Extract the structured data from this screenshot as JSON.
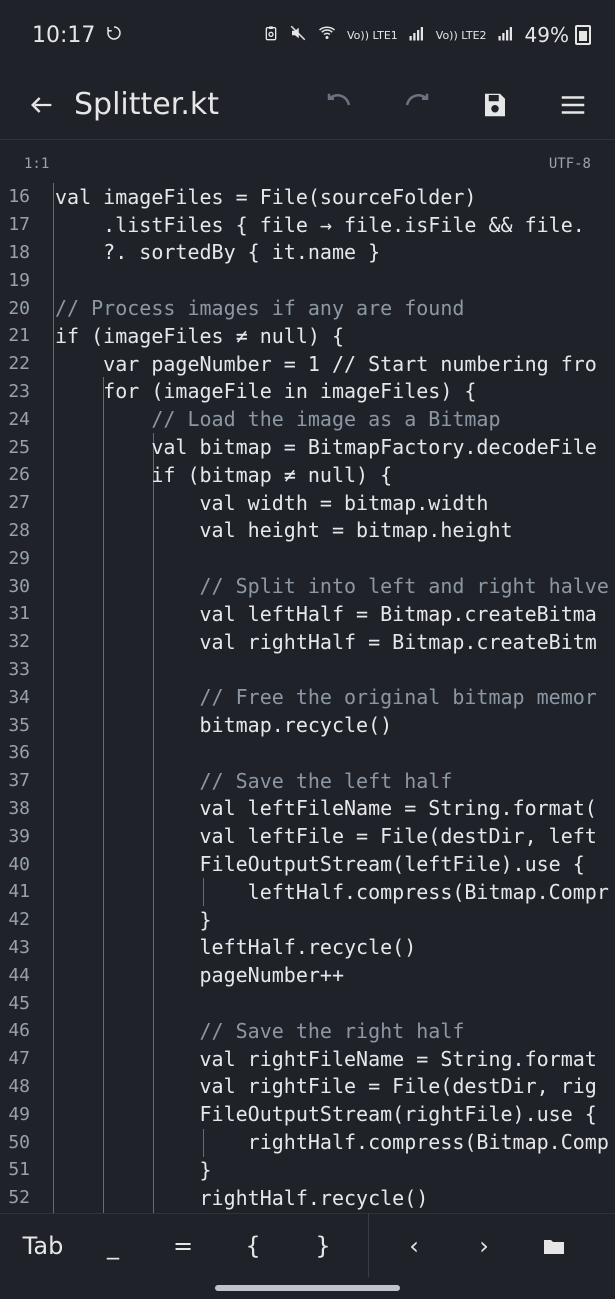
{
  "status": {
    "time": "10:17",
    "signal1": "Vo))\nLTE1",
    "signal2": "Vo))\nLTE2",
    "battery": "49%"
  },
  "appbar": {
    "title": "Splitter.kt"
  },
  "info": {
    "cursor": "1:1",
    "encoding": "UTF-8"
  },
  "editor": {
    "lines": [
      {
        "n": "16",
        "text": "val imageFiles = File(sourceFolder)"
      },
      {
        "n": "17",
        "text": "    .listFiles { file → file.isFile && file."
      },
      {
        "n": "18",
        "text": "    ?. sortedBy { it.name }"
      },
      {
        "n": "19",
        "text": ""
      },
      {
        "n": "20",
        "text": "// Process images if any are found"
      },
      {
        "n": "21",
        "text": "if (imageFiles ≠ null) {"
      },
      {
        "n": "22",
        "text": "    var pageNumber = 1 // Start numbering fro"
      },
      {
        "n": "23",
        "text": "    for (imageFile in imageFiles) {"
      },
      {
        "n": "24",
        "text": "        // Load the image as a Bitmap"
      },
      {
        "n": "25",
        "text": "        val bitmap = BitmapFactory.decodeFile"
      },
      {
        "n": "26",
        "text": "        if (bitmap ≠ null) {"
      },
      {
        "n": "27",
        "text": "            val width = bitmap.width"
      },
      {
        "n": "28",
        "text": "            val height = bitmap.height"
      },
      {
        "n": "29",
        "text": ""
      },
      {
        "n": "30",
        "text": "            // Split into left and right halve"
      },
      {
        "n": "31",
        "text": "            val leftHalf = Bitmap.createBitma"
      },
      {
        "n": "32",
        "text": "            val rightHalf = Bitmap.createBitm"
      },
      {
        "n": "33",
        "text": ""
      },
      {
        "n": "34",
        "text": "            // Free the original bitmap memor"
      },
      {
        "n": "35",
        "text": "            bitmap.recycle()"
      },
      {
        "n": "36",
        "text": ""
      },
      {
        "n": "37",
        "text": "            // Save the left half"
      },
      {
        "n": "38",
        "text": "            val leftFileName = String.format("
      },
      {
        "n": "39",
        "text": "            val leftFile = File(destDir, left"
      },
      {
        "n": "40",
        "text": "            FileOutputStream(leftFile).use { "
      },
      {
        "n": "41",
        "text": "                leftHalf.compress(Bitmap.Compr"
      },
      {
        "n": "42",
        "text": "            }"
      },
      {
        "n": "43",
        "text": "            leftHalf.recycle()"
      },
      {
        "n": "44",
        "text": "            pageNumber++"
      },
      {
        "n": "45",
        "text": ""
      },
      {
        "n": "46",
        "text": "            // Save the right half"
      },
      {
        "n": "47",
        "text": "            val rightFileName = String.format"
      },
      {
        "n": "48",
        "text": "            val rightFile = File(destDir, rig"
      },
      {
        "n": "49",
        "text": "            FileOutputStream(rightFile).use {"
      },
      {
        "n": "50",
        "text": "                rightHalf.compress(Bitmap.Comp"
      },
      {
        "n": "51",
        "text": "            }"
      },
      {
        "n": "52",
        "text": "            rightHalf.recycle()"
      }
    ]
  },
  "bottombar": {
    "tab": "Tab",
    "underscore": "_",
    "equals": "=",
    "lbrace": "{",
    "rbrace": "}",
    "left": "‹",
    "right": "›"
  },
  "icons": {
    "back": "back-arrow-icon",
    "undo": "undo-icon",
    "redo": "redo-icon",
    "save": "save-icon",
    "menu": "menu-icon",
    "folder": "folder-icon"
  }
}
